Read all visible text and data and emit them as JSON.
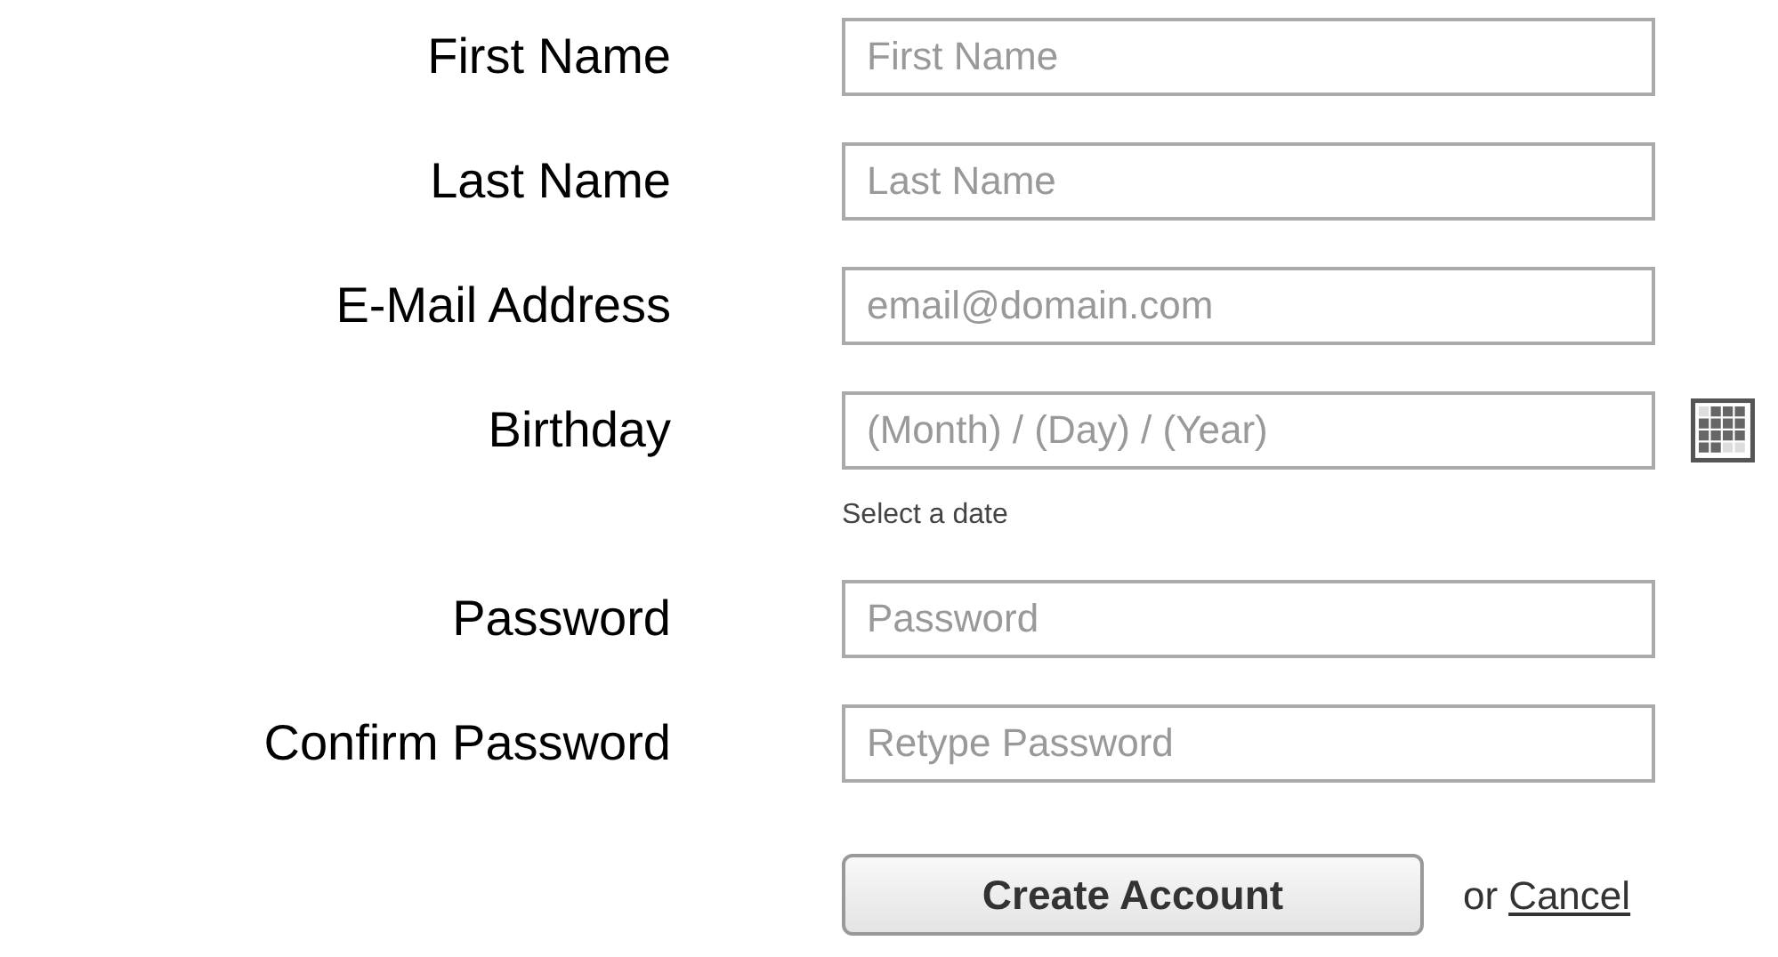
{
  "fields": [
    {
      "label": "First Name",
      "placeholder": "First Name",
      "kind": "text"
    },
    {
      "label": "Last Name",
      "placeholder": "Last Name",
      "kind": "text"
    },
    {
      "label": "E-Mail Address",
      "placeholder": "email@domain.com",
      "kind": "text"
    },
    {
      "label": "Birthday",
      "placeholder": "(Month) / (Day) / (Year)",
      "kind": "date",
      "hint": "Select a date"
    },
    {
      "label": "Password",
      "placeholder": "Password",
      "kind": "text"
    },
    {
      "label": "Confirm Password",
      "placeholder": "Retype Password",
      "kind": "text"
    }
  ],
  "submit": "Create Account",
  "separator": "or",
  "cancel": "Cancel"
}
